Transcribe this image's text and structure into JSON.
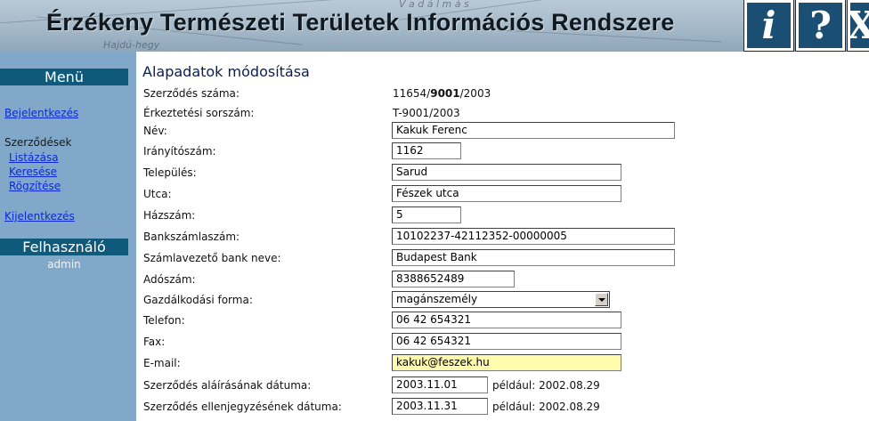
{
  "header": {
    "title": "Érzékeny Természeti Területek Információs Rendszere",
    "map_labels": [
      "V a d á l m á s",
      "Hajdú-hegy"
    ],
    "info_label": "i",
    "help_label": "?",
    "close_label": "X"
  },
  "sidebar": {
    "menu_heading": "Menü",
    "login_link": "Bejelentkezés",
    "contracts_heading": "Szerződések",
    "contract_links": [
      "Listázása",
      "Keresése",
      "Rögzítése"
    ],
    "logout_link": "Kijelentkezés",
    "user_heading": "Felhasználó",
    "user_name": "admin"
  },
  "form": {
    "title": "Alapadatok módosítása",
    "contract_number": {
      "label": "Szerződés száma:",
      "prefix": "11654/",
      "bold": "9001",
      "suffix": "/2003"
    },
    "filing_number": {
      "label": "Érkeztetési sorszám:",
      "value": "T-9001/2003"
    },
    "name": {
      "label": "Név:",
      "value": "Kakuk Ferenc"
    },
    "zip": {
      "label": "Irányítószám:",
      "value": "1162"
    },
    "city": {
      "label": "Település:",
      "value": "Sarud"
    },
    "street": {
      "label": "Utca:",
      "value": "Fészek utca"
    },
    "house_number": {
      "label": "Házszám:",
      "value": "5"
    },
    "bank_account": {
      "label": "Bankszámlaszám:",
      "value": "10102237-42112352-00000005"
    },
    "bank_name": {
      "label": "Számlavezető bank neve:",
      "value": "Budapest Bank"
    },
    "tax_number": {
      "label": "Adószám:",
      "value": "8388652489"
    },
    "business_form": {
      "label": "Gazdálkodási forma:",
      "value": "magánszemély"
    },
    "phone": {
      "label": "Telefon:",
      "value": "06 42 654321"
    },
    "fax": {
      "label": "Fax:",
      "value": "06 42 654321"
    },
    "email": {
      "label": "E-mail:",
      "value": "kakuk@feszek.hu"
    },
    "signing_date": {
      "label": "Szerződés aláírásának dátuma:",
      "value": "2003.11.01",
      "hint": "például: 2002.08.29"
    },
    "countersign_date": {
      "label": "Szerződés ellenjegyzésének dátuma:",
      "value": "2003.11.31",
      "hint": "például: 2002.08.29"
    }
  }
}
